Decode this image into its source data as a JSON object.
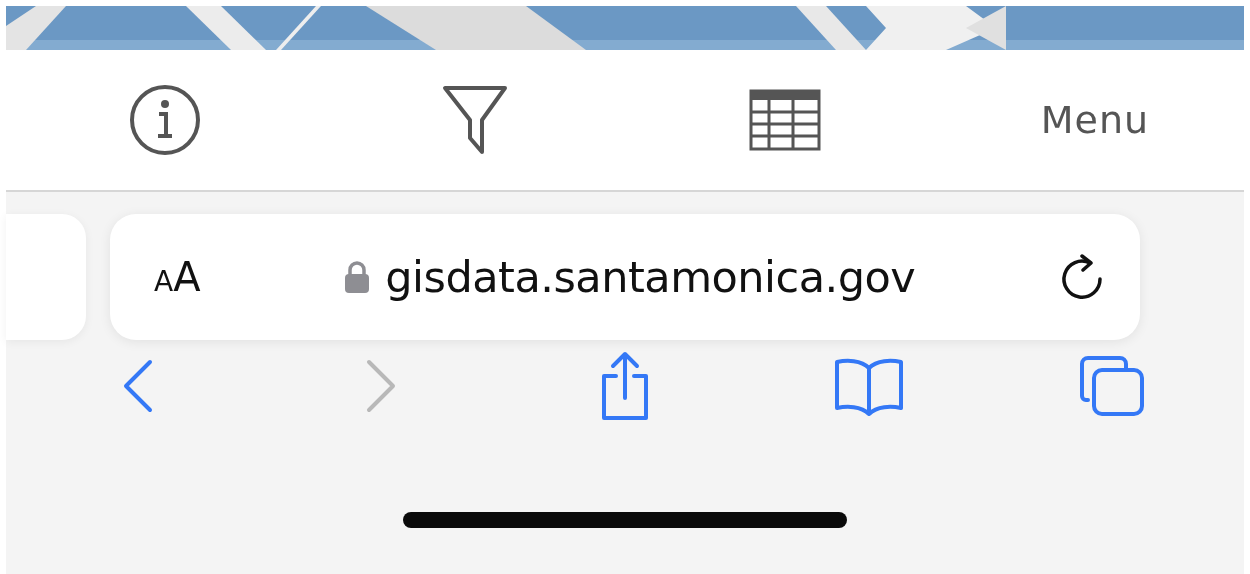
{
  "toolbar": {
    "items": [
      {
        "kind": "info"
      },
      {
        "kind": "filter"
      },
      {
        "kind": "table"
      },
      {
        "kind": "text",
        "label": "Menu"
      }
    ]
  },
  "address_bar": {
    "text_size_button": {
      "small": "A",
      "large": "A"
    },
    "secure": true,
    "url": "gisdata.santamonica.gov"
  },
  "nav_bar": {
    "items": [
      {
        "kind": "back",
        "disabled": false
      },
      {
        "kind": "forward",
        "disabled": true
      },
      {
        "kind": "share",
        "disabled": false
      },
      {
        "kind": "bookmarks",
        "disabled": false
      },
      {
        "kind": "tabs",
        "disabled": false
      }
    ]
  }
}
